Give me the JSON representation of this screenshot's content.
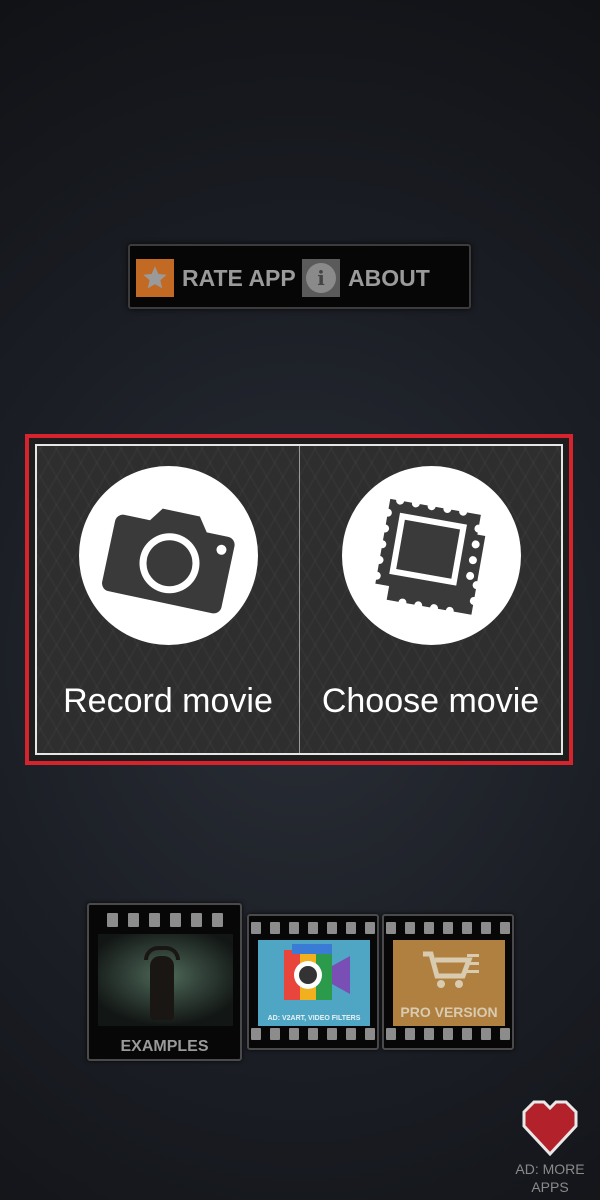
{
  "topbar": {
    "rate_label": "RATE APP",
    "about_label": "ABOUT",
    "about_glyph": "i"
  },
  "main": {
    "record_label": "Record movie",
    "choose_label": "Choose movie"
  },
  "thumbnails": {
    "examples_label": "EXAMPLES",
    "ad_label": "AD: V2ART, VIDEO FILTERS",
    "pro_label": "PRO VERSION"
  },
  "more_apps": {
    "line1": "AD: MORE",
    "line2": "APPS"
  },
  "colors": {
    "highlight_border": "#d6232e",
    "rate_icon_bg": "#c26a23",
    "heart": "#b3222a"
  },
  "icons": [
    "star-icon",
    "info-icon",
    "camera-icon",
    "gallery-stamp-icon",
    "heart-icon"
  ]
}
